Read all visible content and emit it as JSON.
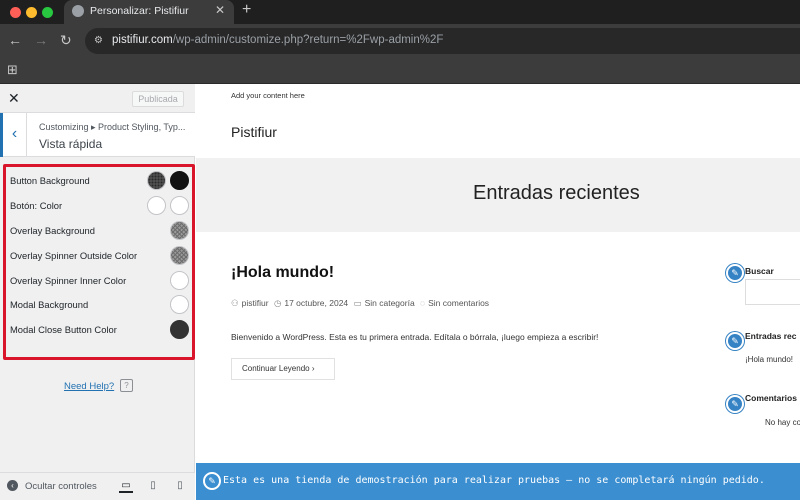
{
  "browser": {
    "tab_title": "Personalizar: Pistifiur",
    "url_domain": "pistifiur.com",
    "url_path": "/wp-admin/customize.php?return=%2Fwp-admin%2F"
  },
  "customizer": {
    "publish_label": "Publicada",
    "breadcrumb": "Customizing ▸ Product Styling, Typ...",
    "section_title": "Vista rápida",
    "controls": [
      {
        "label": "Button Background",
        "swatches": [
          "dotted-dark",
          "black"
        ]
      },
      {
        "label": "Botón: Color",
        "swatches": [
          "white",
          "white"
        ]
      },
      {
        "label": "Overlay Background",
        "swatches": [
          "checker"
        ]
      },
      {
        "label": "Overlay Spinner Outside Color",
        "swatches": [
          "checker"
        ]
      },
      {
        "label": "Overlay Spinner Inner Color",
        "swatches": [
          "white"
        ]
      },
      {
        "label": "Modal Background",
        "swatches": [
          "white"
        ]
      },
      {
        "label": "Modal Close Button Color",
        "swatches": [
          "dark"
        ]
      }
    ],
    "help_link": "Need Help?",
    "hide_controls": "Ocultar controles"
  },
  "preview": {
    "topbar_text": "Add your content here",
    "site_title": "Pistifiur",
    "hero_title": "Entradas recientes",
    "post": {
      "title": "¡Hola mundo!",
      "author": "pistifiur",
      "date": "17 octubre, 2024",
      "category": "Sin categoría",
      "comments": "Sin comentarios",
      "excerpt": "Bienvenido a WordPress. Esta es tu primera entrada. Edítala o bórrala, ¡luego empieza a escribir!",
      "read_more": "Continuar Leyendo"
    },
    "widgets": {
      "search_title": "Buscar",
      "recent_title": "Entradas rec",
      "recent_item": "¡Hola mundo!",
      "comments_title": "Comentarios",
      "comments_text": "No hay co"
    },
    "demo_notice": "Esta es una tienda de demostración para realizar pruebas — no se completará ningún pedido."
  },
  "colors": {
    "accent": "#2271b1",
    "highlight_border": "#d9152b",
    "demo_bar": "#3b8ed0"
  }
}
